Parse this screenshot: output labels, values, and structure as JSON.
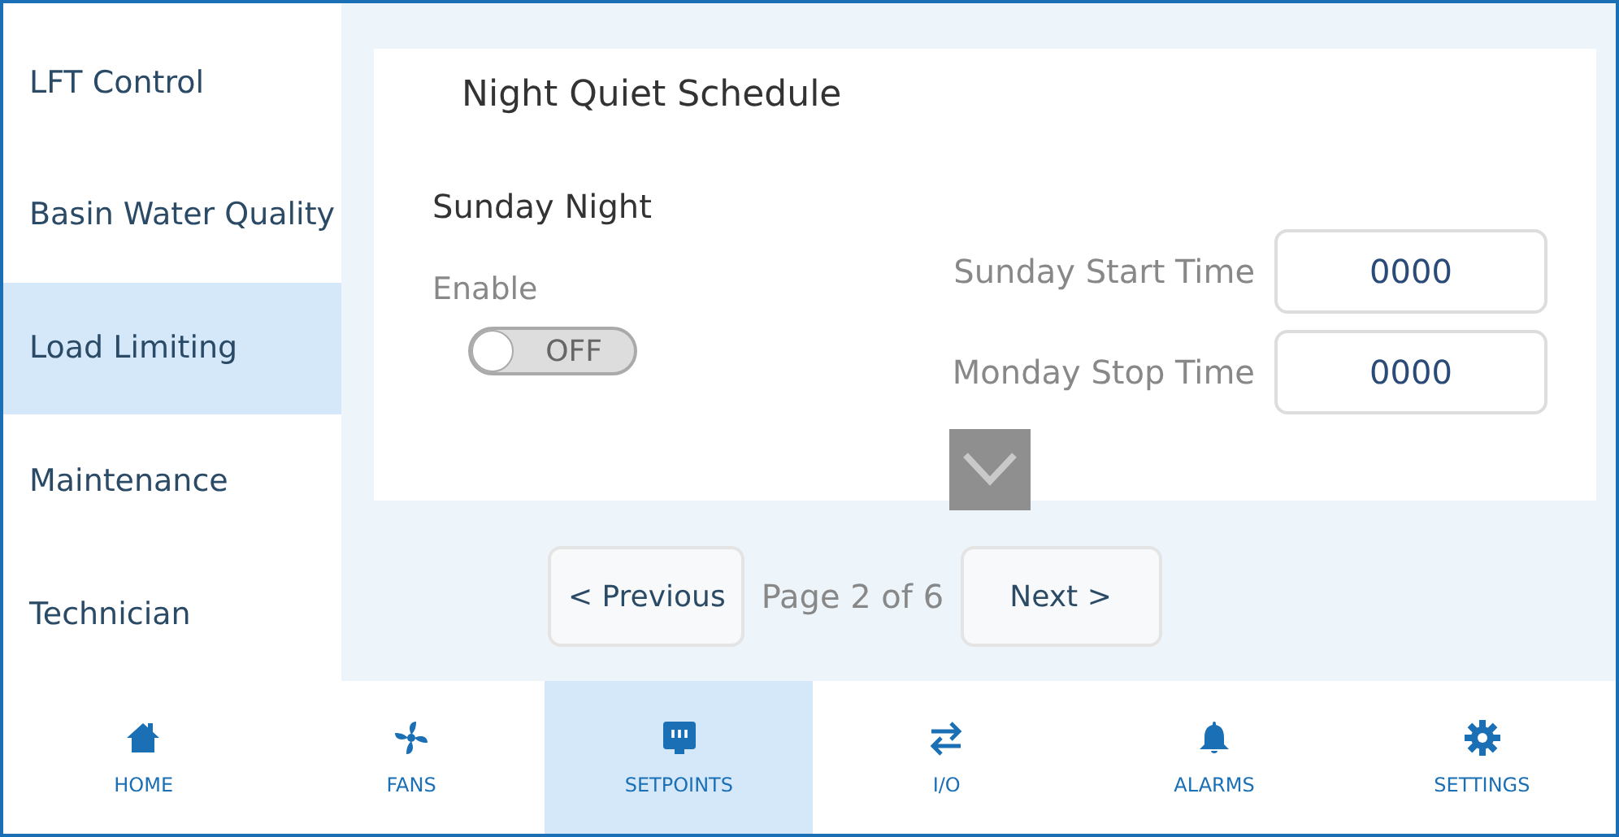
{
  "sidebar": {
    "items": [
      {
        "label": "LFT Control",
        "selected": false
      },
      {
        "label": "Basin Water Quality",
        "selected": false
      },
      {
        "label": "Load Limiting",
        "selected": true
      },
      {
        "label": "Maintenance",
        "selected": false
      },
      {
        "label": "Technician",
        "selected": false
      }
    ]
  },
  "card": {
    "title": "Night Quiet Schedule",
    "section": "Sunday Night",
    "enable": {
      "label": "Enable",
      "on": false,
      "state_text": "OFF"
    },
    "fields": [
      {
        "label": "Sunday Start Time",
        "value": "0000"
      },
      {
        "label": "Monday Stop Time",
        "value": "0000"
      }
    ]
  },
  "pager": {
    "previous": "< Previous",
    "page": "Page 2 of 6",
    "next": "Next >"
  },
  "nav": [
    {
      "kind": "home",
      "label": "HOME",
      "selected": false
    },
    {
      "kind": "fan",
      "label": "FANS",
      "selected": false
    },
    {
      "kind": "setpoints",
      "label": "SETPOINTS",
      "selected": true
    },
    {
      "kind": "io",
      "label": "I/O",
      "selected": false
    },
    {
      "kind": "alarm",
      "label": "ALARMS",
      "selected": false
    },
    {
      "kind": "settings",
      "label": "SETTINGS",
      "selected": false
    }
  ]
}
